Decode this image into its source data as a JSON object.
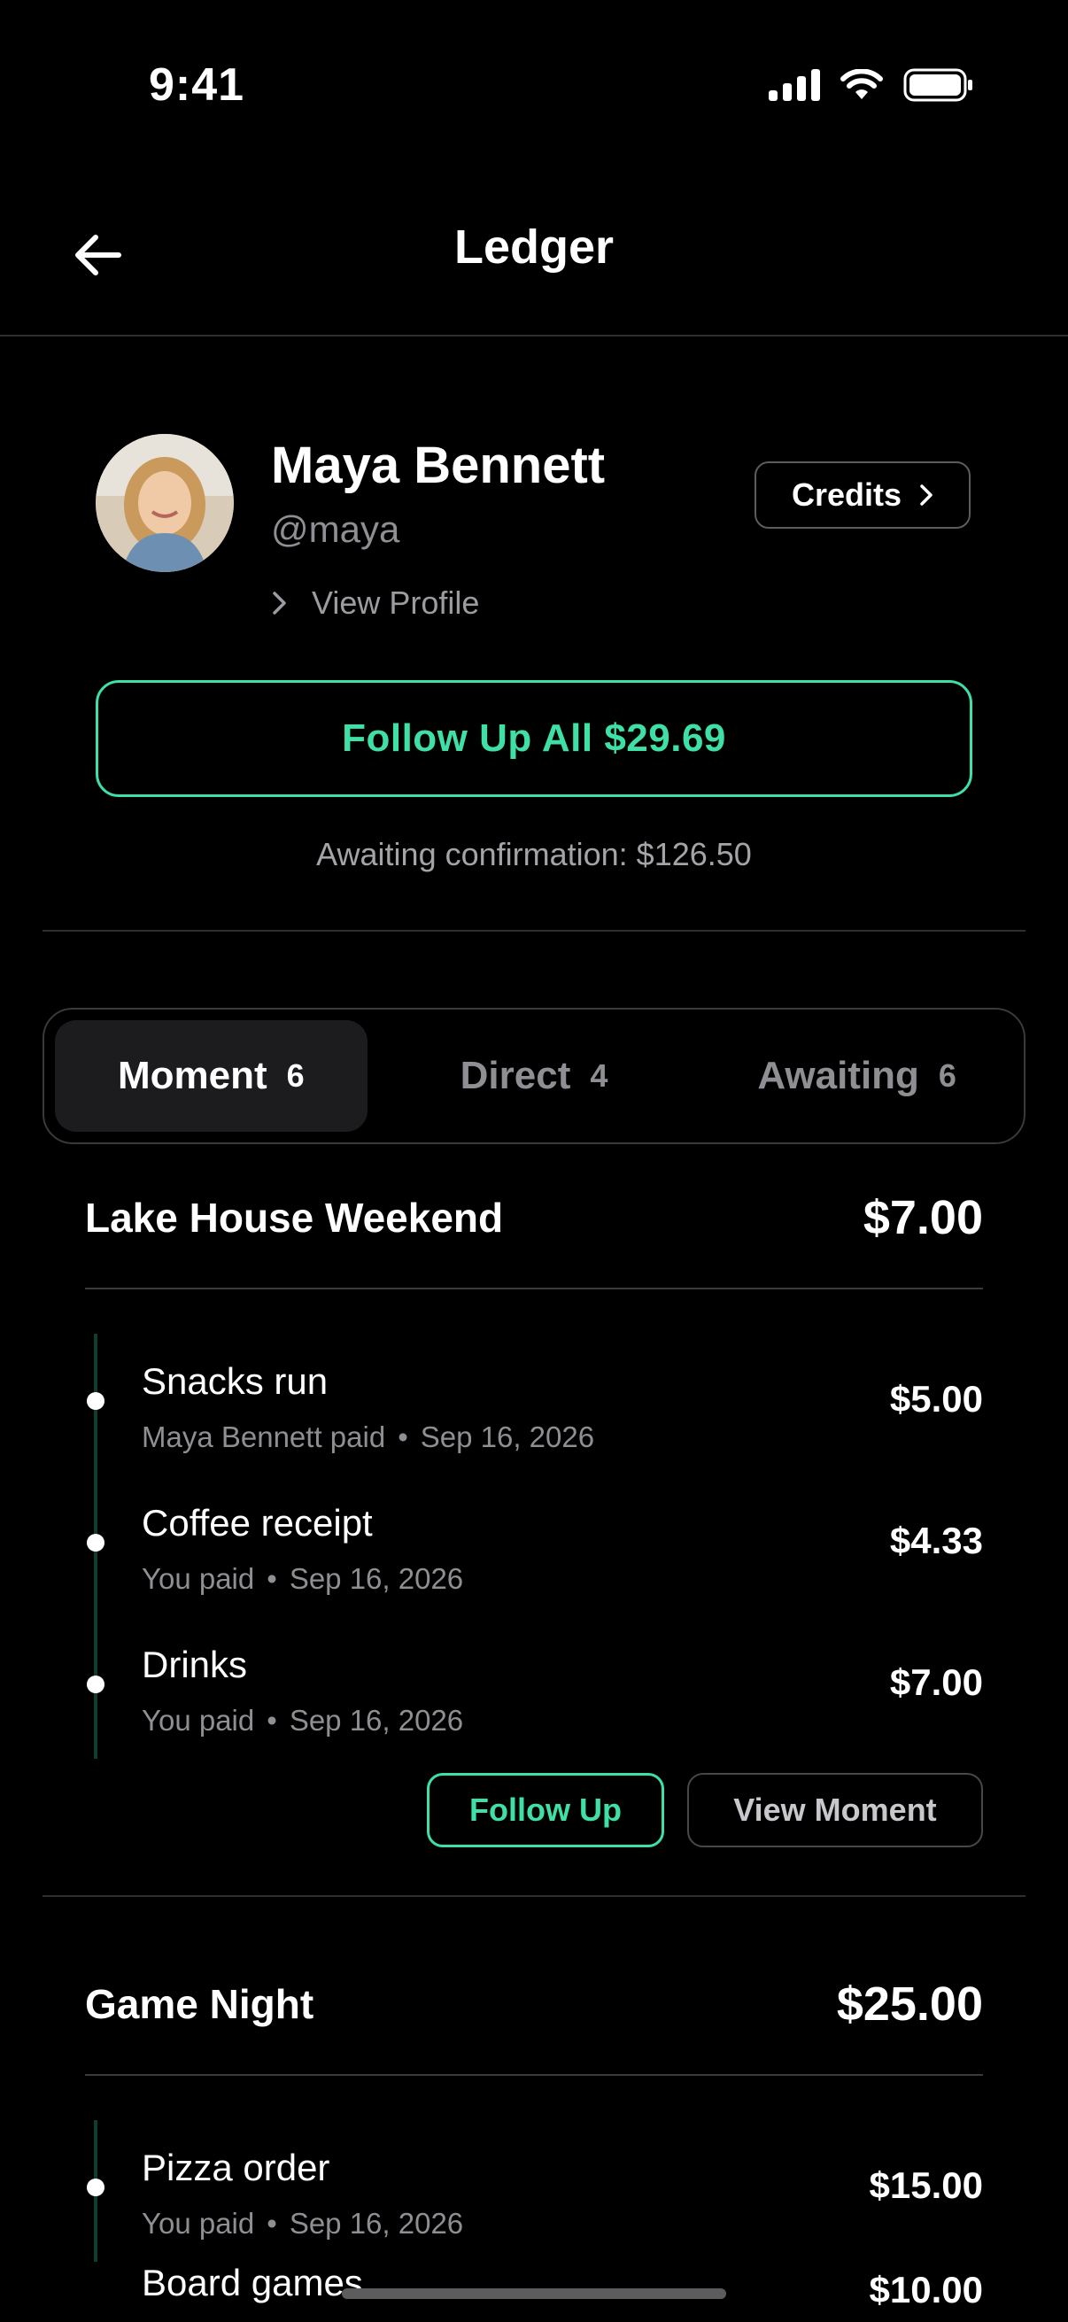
{
  "status": {
    "time": "9:41"
  },
  "nav": {
    "title": "Ledger"
  },
  "profile": {
    "name": "Maya Bennett",
    "handle": "@maya",
    "view_profile": "View Profile",
    "credits": "Credits"
  },
  "follow_up_all": "Follow Up All $29.69",
  "awaiting_confirmation": "Awaiting confirmation: $126.50",
  "tabs": [
    {
      "label": "Moment",
      "count": "6"
    },
    {
      "label": "Direct",
      "count": "4"
    },
    {
      "label": "Awaiting",
      "count": "6"
    }
  ],
  "groups": [
    {
      "title": "Lake House Weekend",
      "total": "$7.00",
      "items": [
        {
          "title": "Snacks run",
          "payer": "Maya Bennett paid",
          "date": "Sep 16, 2026",
          "amount": "$5.00"
        },
        {
          "title": "Coffee receipt",
          "payer": "You paid",
          "date": "Sep 16, 2026",
          "amount": "$4.33"
        },
        {
          "title": "Drinks",
          "payer": "You paid",
          "date": "Sep 16, 2026",
          "amount": "$7.00"
        }
      ],
      "follow_up": "Follow Up",
      "view_moment": "View Moment"
    },
    {
      "title": "Game Night",
      "total": "$25.00",
      "items": [
        {
          "title": "Pizza order",
          "payer": "You paid",
          "date": "Sep 16, 2026",
          "amount": "$15.00"
        },
        {
          "title": "Board games",
          "payer": "",
          "date": "",
          "amount": "$10.00"
        }
      ]
    }
  ],
  "colors": {
    "accent": "#3fe0a6",
    "background": "#000000",
    "muted": "#8e8e93"
  }
}
